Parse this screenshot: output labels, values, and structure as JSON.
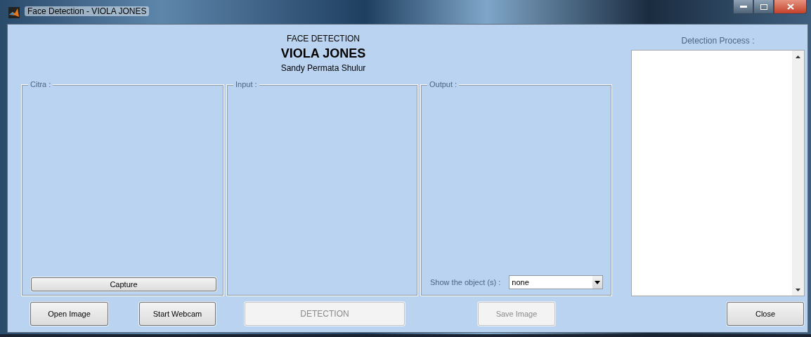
{
  "window": {
    "title": "Face Detection - VIOLA JONES"
  },
  "header": {
    "subtitle": "FACE DETECTION",
    "title": "VIOLA JONES",
    "author": "Sandy Permata Shulur"
  },
  "panels": [
    {
      "title": "Citra :",
      "kind": "citra",
      "button": "Capture"
    },
    {
      "title": "Input :",
      "kind": "plain"
    },
    {
      "title": "Output :",
      "kind": "output",
      "show_label": "Show the object (s) :",
      "dropdown": "none"
    }
  ],
  "detection_process": {
    "label": "Detection Process :"
  },
  "buttons": [
    {
      "label": "Open Image",
      "disabled": false
    },
    {
      "label": "Start Webcam",
      "disabled": false
    },
    {
      "label": "DETECTION",
      "disabled": true
    },
    {
      "label": "Save Image",
      "disabled": true
    }
  ],
  "close_button": {
    "label": "Close",
    "disabled": false
  }
}
